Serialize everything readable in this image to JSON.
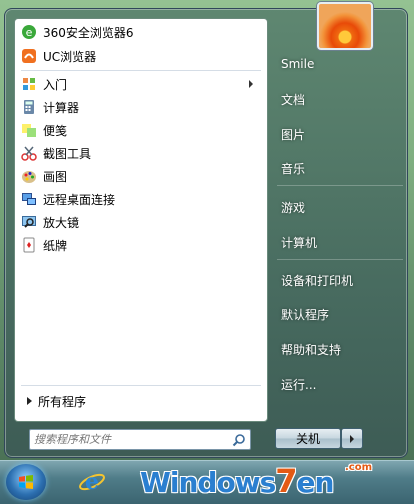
{
  "left_panel": {
    "pinned": [
      {
        "label": "360安全浏览器6",
        "icon": "360-browser-icon"
      },
      {
        "label": "UC浏览器",
        "icon": "uc-browser-icon"
      }
    ],
    "recent": [
      {
        "label": "入门",
        "icon": "getting-started-icon",
        "has_submenu": true
      },
      {
        "label": "计算器",
        "icon": "calculator-icon"
      },
      {
        "label": "便笺",
        "icon": "sticky-notes-icon"
      },
      {
        "label": "截图工具",
        "icon": "snipping-tool-icon"
      },
      {
        "label": "画图",
        "icon": "paint-icon"
      },
      {
        "label": "远程桌面连接",
        "icon": "remote-desktop-icon"
      },
      {
        "label": "放大镜",
        "icon": "magnifier-icon"
      },
      {
        "label": "纸牌",
        "icon": "solitaire-icon"
      }
    ],
    "all_programs": "所有程序",
    "search_placeholder": "搜索程序和文件"
  },
  "right_panel": {
    "items": [
      {
        "label": "Smile"
      },
      {
        "label": "文档"
      },
      {
        "label": "图片"
      },
      {
        "label": "音乐"
      },
      {
        "label": "游戏"
      },
      {
        "label": "计算机"
      },
      {
        "label": "设备和打印机"
      },
      {
        "label": "默认程序"
      },
      {
        "label": "帮助和支持"
      },
      {
        "label": "运行..."
      }
    ],
    "shutdown_label": "关机"
  },
  "watermark": {
    "text_a": "Windows",
    "text_b": "7",
    "text_c": "en",
    "domain": ".com"
  },
  "colors": {
    "accent_blue": "#2a7fd0",
    "accent_orange": "#e45a14"
  }
}
